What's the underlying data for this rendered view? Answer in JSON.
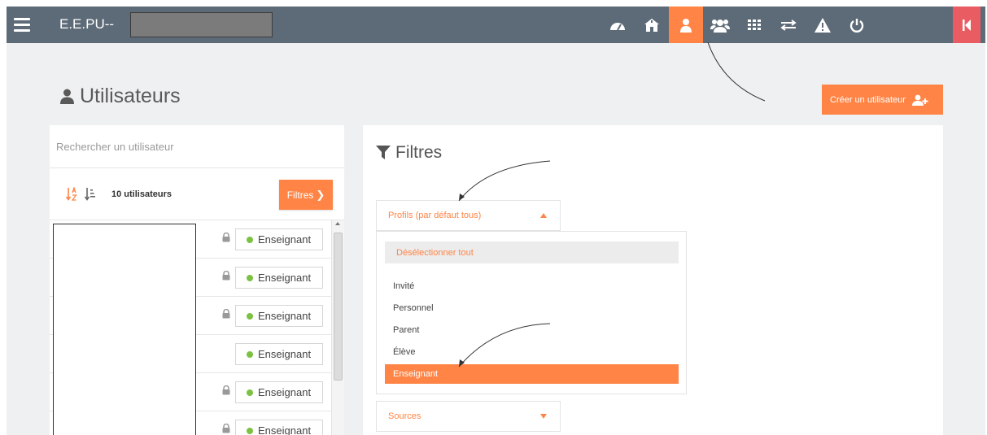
{
  "header": {
    "school_name": "E.E.PU--",
    "nav_icons": [
      "dashboard-icon",
      "school-icon",
      "user-icon",
      "users-icon",
      "grid-icon",
      "exchange-icon",
      "warning-icon",
      "power-icon",
      "collapse-icon"
    ],
    "active_icon": "user-icon"
  },
  "page": {
    "title": "Utilisateurs",
    "create_button": "Créer un utilisateur"
  },
  "user_list": {
    "search_placeholder": "Rechercher un utilisateur",
    "count_label": "10 utilisateurs",
    "filter_button": "Filtres",
    "rows": [
      {
        "role": "Enseignant",
        "locked": true
      },
      {
        "role": "Enseignant",
        "locked": true
      },
      {
        "role": "Enseignant",
        "locked": true
      },
      {
        "role": "Enseignant",
        "locked": false
      },
      {
        "role": "Enseignant",
        "locked": true
      },
      {
        "role": "Enseignant",
        "locked": true
      }
    ]
  },
  "filters": {
    "title": "Filtres",
    "profiles": {
      "header": "Profils (par défaut tous)",
      "deselect_all": "Désélectionner tout",
      "options": [
        "Invité",
        "Personnel",
        "Parent",
        "Élève",
        "Enseignant"
      ],
      "selected": "Enseignant"
    },
    "sources": {
      "header": "Sources"
    }
  },
  "colors": {
    "accent": "#ff8445",
    "topbar": "#5d6b78",
    "danger": "#e85c62",
    "status_dot": "#7cc242"
  }
}
